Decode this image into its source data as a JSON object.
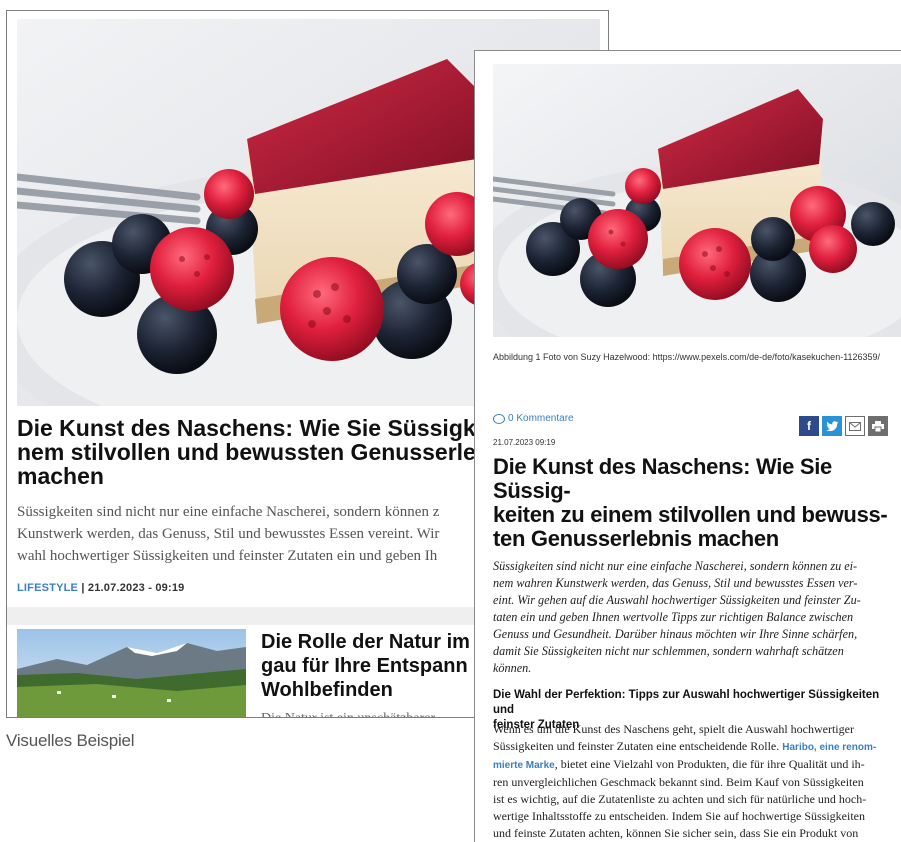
{
  "left_card": {
    "title": "Die Kunst des Naschens: Wie Sie Süssigk\nnem stilvollen und bewussten Genusserle\nmachen",
    "teaser": "Süssigkeiten sind nicht nur eine einfache Nascherei, sondern können z\nKunstwerk werden, das Genuss, Stil und bewusstes Essen vereint. Wir\nwahl hochwertiger Süssigkeiten und feinster Zutaten ein und geben Ih",
    "category": "LIFESTYLE",
    "separator": "|",
    "date": "21.07.2023 - 09:19",
    "second_title": "Die Rolle der Natur im\ngau für Ihre Entspann\nWohlbefinden",
    "second_teaser": "Die Natur ist ein unschätzbarer"
  },
  "caption_label": "Visuelles Beispiel",
  "right_card": {
    "image_caption": "Abbildung 1 Foto von Suzy Hazelwood: https://www.pexels.com/de-de/foto/kasekuchen-1126359/",
    "comments": "0 Kommentare",
    "date": "21.07.2023 09:19",
    "title": "Die Kunst des Naschens: Wie Sie Süssig-\nkeiten zu einem stilvollen und bewuss-\nten Genusserlebnis machen",
    "lead": "Süssigkeiten sind nicht nur eine einfache Nascherei, sondern können zu ei-\nnem wahren Kunstwerk werden, das Genuss, Stil und bewusstes Essen ver-\neint. Wir gehen auf die Auswahl hochwertiger Süssigkeiten und feinster Zu-\ntaten ein und geben Ihnen wertvolle Tipps zur richtigen Balance zwischen\nGenuss und Gesundheit. Darüber hinaus möchten wir Ihre Sinne schärfen,\ndamit Sie Süssigkeiten nicht nur schlemmen, sondern wahrhaft schätzen\nkönnen.",
    "subheading": "Die Wahl der Perfektion: Tipps zur Auswahl hochwertiger Süssigkeiten und\nfeinster Zutaten",
    "body_before_link": "Wenn es um die Kunst des Naschens geht, spielt die Auswahl hochwertiger\nSüssigkeiten und feinster Zutaten eine entscheidende Rolle. ",
    "body_link": "Haribo, eine renom-\nmierte Marke",
    "body_after_link": ", bietet eine Vielzahl von Produkten, die für ihre Qualität und ih-\nren unvergleichlichen Geschmack bekannt sind. Beim Kauf von Süssigkeiten\nist es wichtig, auf die Zutatenliste zu achten und sich für natürliche und hoch-\nwertige Inhaltsstoffe zu entscheiden. Indem Sie auf hochwertige Süssigkeiten\nund feinste Zutaten achten, können Sie sicher sein, dass Sie ein Produkt von",
    "share_icons": [
      "facebook-icon",
      "twitter-icon",
      "mail-icon",
      "print-icon"
    ]
  },
  "colors": {
    "accent_blue": "#3a7fc2",
    "facebook": "#2c4a8c",
    "twitter": "#2a93d6",
    "raspberry": "#d8233f",
    "blueberry": "#1a2130"
  }
}
